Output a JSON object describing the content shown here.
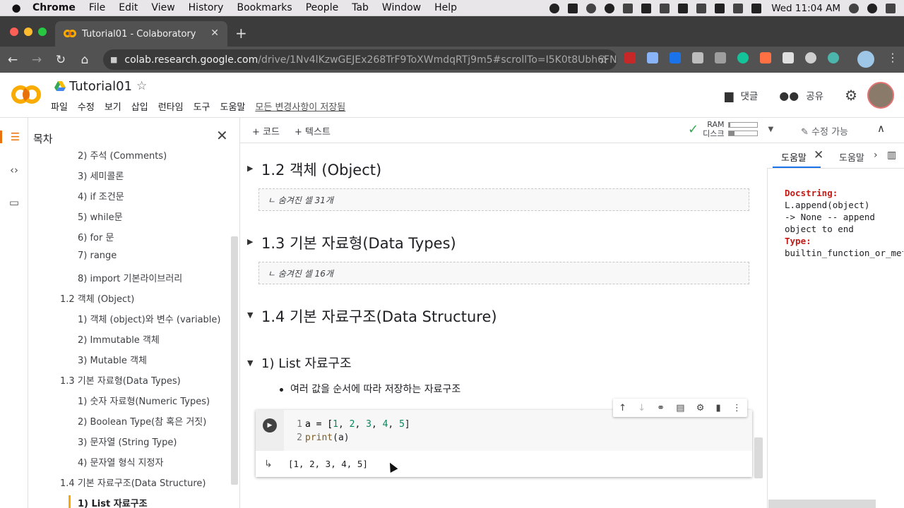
{
  "mac_menubar": {
    "apple": "",
    "app": "Chrome",
    "items": [
      "File",
      "Edit",
      "View",
      "History",
      "Bookmarks",
      "People",
      "Tab",
      "Window",
      "Help"
    ],
    "clock": "Wed 11:04 AM",
    "input_source": "A"
  },
  "browser": {
    "tab_title": "Tutorial01 - Colaboratory",
    "tab_close": "✕",
    "new_tab": "+",
    "back": "←",
    "forward": "→",
    "reload": "↻",
    "home": "⌂",
    "url_domain": "colab.research.google.com",
    "url_path": "/drive/1Nv4lKzwGEJEx268TrF9ToXWmdqRTj9m5#scrollTo=I5K0t8Ubh6FN",
    "bookmark_star": "☆",
    "menu": "⋮"
  },
  "colab": {
    "doc_title": "Tutorial01",
    "title_star": "☆",
    "menu": [
      "파일",
      "수정",
      "보기",
      "삽입",
      "런타임",
      "도구",
      "도움말"
    ],
    "saved_status": "모든 변경사항이 저장됨",
    "comments_label": "댓글",
    "share_label": "공유",
    "gear": "⚙"
  },
  "toc": {
    "title": "목차",
    "close": "✕",
    "items": [
      {
        "label": "2) 주석 (Comments)",
        "level": 2
      },
      {
        "label": "3) 세미콜론",
        "level": 2
      },
      {
        "label": "4) if 조건문",
        "level": 2
      },
      {
        "label": "5) while문",
        "level": 2
      },
      {
        "label": "6) for 문",
        "level": 2
      },
      {
        "label": "7) range",
        "level": 2
      },
      {
        "label": "8) import 기본라이브러리",
        "level": 2
      },
      {
        "label": "1.2 객체 (Object)",
        "level": 1
      },
      {
        "label": "1) 객체 (object)와 변수 (variable)",
        "level": 2
      },
      {
        "label": "2) Immutable 객체",
        "level": 2
      },
      {
        "label": "3) Mutable 객체",
        "level": 2
      },
      {
        "label": "1.3 기본 자료형(Data Types)",
        "level": 1
      },
      {
        "label": "1) 숫자 자료형(Numeric Types)",
        "level": 2
      },
      {
        "label": "2) Boolean Type(참 혹은 거짓)",
        "level": 2
      },
      {
        "label": "3) 문자열 (String Type)",
        "level": 2
      },
      {
        "label": "4) 문자열 형식 지정자",
        "level": 2
      },
      {
        "label": "1.4 기본 자료구조(Data Structure)",
        "level": 1
      },
      {
        "label": "1) List 자료구조",
        "level": 2,
        "selected": true
      }
    ]
  },
  "nb_toolbar": {
    "add_code": "+ 코드",
    "add_text": "+ 텍스트",
    "ram_label": "RAM",
    "disk_label": "디스크",
    "ram_usage": 0.05,
    "disk_usage": 0.2,
    "edit_label": "수정 가능",
    "collapse": "∧"
  },
  "notebook": {
    "sections": [
      {
        "title": "1.2 객체 (Object)",
        "collapsed": true,
        "hidden_cells": "ㄴ 숨겨진 셀 31개"
      },
      {
        "title": "1.3 기본 자료형(Data Types)",
        "collapsed": true,
        "hidden_cells": "ㄴ 숨겨진 셀 16개"
      },
      {
        "title": "1.4 기본 자료구조(Data Structure)",
        "collapsed": false
      }
    ],
    "subsection": "1) List 자료구조",
    "bullet": "여러 값을 순서에 따라 저장하는 자료구조",
    "code": {
      "line1_no": "1",
      "line2_no": "2",
      "line1_a": "a = [",
      "n1": "1",
      "n2": "2",
      "n3": "3",
      "n4": "4",
      "n5": "5",
      "sep": ", ",
      "close": "]",
      "line2_fn": "print",
      "line2_arg": "(a)"
    },
    "output": "[1, 2, 3, 4, 5]"
  },
  "help": {
    "tab1": "도움말",
    "tab2": "도움말",
    "close": "✕",
    "next": "›",
    "docstring_key": "Docstring:",
    "docstring_lines": [
      "L.append(object)",
      "-> None -- append",
      "object to end"
    ],
    "type_key": "Type:",
    "type_value": "builtin_function_or_method"
  },
  "colors": {
    "accent_orange": "#e8710a",
    "accent_yellow": "#f9ab00",
    "link_blue": "#1a73e8",
    "chrome_dark": "#3c3c3c"
  }
}
